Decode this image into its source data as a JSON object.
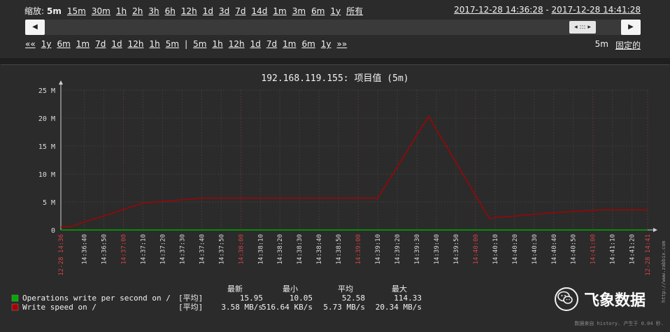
{
  "zoom": {
    "label": "缩放:",
    "options": [
      "5m",
      "15m",
      "30m",
      "1h",
      "2h",
      "3h",
      "6h",
      "12h",
      "1d",
      "3d",
      "7d",
      "14d",
      "1m",
      "3m",
      "6m",
      "1y",
      "所有"
    ],
    "selected": "5m"
  },
  "range": {
    "from": "2017-12-28 14:36:28",
    "dash": " - ",
    "to": "2017-12-28 14:41:28"
  },
  "scroll": {
    "left_arrow": "◀",
    "right_arrow": "▶",
    "handle": "◂ ::: ▸"
  },
  "nav": {
    "back_all": "««",
    "back": [
      "1y",
      "6m",
      "1m",
      "7d",
      "1d",
      "12h",
      "1h",
      "5m"
    ],
    "sep": "|",
    "fwd": [
      "5m",
      "1h",
      "12h",
      "1d",
      "7d",
      "1m",
      "6m",
      "1y"
    ],
    "fwd_all": "»»",
    "period": "5m",
    "fixed": "固定的"
  },
  "chart_data": {
    "type": "line",
    "title": "192.168.119.155: 项目值 (5m)",
    "xlabel": "",
    "ylabel": "",
    "ylim": [
      0,
      25000000
    ],
    "y_ticks": [
      "0",
      "5 M",
      "10 M",
      "15 M",
      "20 M",
      "25 M"
    ],
    "y_tick_values": [
      0,
      5000000,
      10000000,
      15000000,
      20000000,
      25000000
    ],
    "x_start": "14:36:28",
    "x_end": "14:41:28",
    "x_tick_labels": [
      {
        "t": "14:36:28",
        "label": "12-28 14:36",
        "red": true
      },
      {
        "t": "14:36:40",
        "label": "14:36:40",
        "red": false
      },
      {
        "t": "14:36:50",
        "label": "14:36:50",
        "red": false
      },
      {
        "t": "14:37:00",
        "label": "14:37:00",
        "red": true
      },
      {
        "t": "14:37:10",
        "label": "14:37:10",
        "red": false
      },
      {
        "t": "14:37:20",
        "label": "14:37:20",
        "red": false
      },
      {
        "t": "14:37:30",
        "label": "14:37:30",
        "red": false
      },
      {
        "t": "14:37:40",
        "label": "14:37:40",
        "red": false
      },
      {
        "t": "14:37:50",
        "label": "14:37:50",
        "red": false
      },
      {
        "t": "14:38:00",
        "label": "14:38:00",
        "red": true
      },
      {
        "t": "14:38:10",
        "label": "14:38:10",
        "red": false
      },
      {
        "t": "14:38:20",
        "label": "14:38:20",
        "red": false
      },
      {
        "t": "14:38:30",
        "label": "14:38:30",
        "red": false
      },
      {
        "t": "14:38:40",
        "label": "14:38:40",
        "red": false
      },
      {
        "t": "14:38:50",
        "label": "14:38:50",
        "red": false
      },
      {
        "t": "14:39:00",
        "label": "14:39:00",
        "red": true
      },
      {
        "t": "14:39:10",
        "label": "14:39:10",
        "red": false
      },
      {
        "t": "14:39:20",
        "label": "14:39:20",
        "red": false
      },
      {
        "t": "14:39:30",
        "label": "14:39:30",
        "red": false
      },
      {
        "t": "14:39:40",
        "label": "14:39:40",
        "red": false
      },
      {
        "t": "14:39:50",
        "label": "14:39:50",
        "red": false
      },
      {
        "t": "14:40:00",
        "label": "14:40:00",
        "red": true
      },
      {
        "t": "14:40:10",
        "label": "14:40:10",
        "red": false
      },
      {
        "t": "14:40:20",
        "label": "14:40:20",
        "red": false
      },
      {
        "t": "14:40:30",
        "label": "14:40:30",
        "red": false
      },
      {
        "t": "14:40:40",
        "label": "14:40:40",
        "red": false
      },
      {
        "t": "14:40:50",
        "label": "14:40:50",
        "red": false
      },
      {
        "t": "14:41:00",
        "label": "14:41:00",
        "red": true
      },
      {
        "t": "14:41:10",
        "label": "14:41:10",
        "red": false
      },
      {
        "t": "14:41:20",
        "label": "14:41:20",
        "red": false
      },
      {
        "t": "14:41:28",
        "label": "12-28 14:41",
        "red": true
      }
    ],
    "series": [
      {
        "name": "Operations write per second on /",
        "color": "#00aa00",
        "points": [
          [
            "14:36:28",
            16
          ],
          [
            "14:37:10",
            16
          ],
          [
            "14:38:00",
            16
          ],
          [
            "14:39:00",
            16
          ],
          [
            "14:40:00",
            16
          ],
          [
            "14:41:28",
            16
          ]
        ]
      },
      {
        "name": "Write speed on /",
        "color": "#aa0000",
        "points": [
          [
            "14:36:28",
            500000
          ],
          [
            "14:36:33",
            600000
          ],
          [
            "14:37:10",
            4800000
          ],
          [
            "14:37:40",
            5700000
          ],
          [
            "14:39:10",
            5700000
          ],
          [
            "14:39:36",
            20300000
          ],
          [
            "14:40:07",
            2100000
          ],
          [
            "14:40:40",
            3100000
          ],
          [
            "14:41:05",
            3600000
          ],
          [
            "14:41:28",
            3600000
          ]
        ]
      }
    ],
    "legend_header": [
      "最新",
      "最小",
      "平均",
      "最大"
    ],
    "legend_rows": [
      {
        "name": "Operations write per second on /",
        "func": "[平均]",
        "last": "15.95",
        "min": "10.05",
        "avg": "52.58",
        "max": "114.33",
        "color": "#00aa00"
      },
      {
        "name": "Write speed on /",
        "func": "[平均]",
        "last": "3.58 MB/s",
        "min": "516.64 KB/s",
        "avg": "5.73 MB/s",
        "max": "20.34 MB/s",
        "color": "#aa0000"
      }
    ],
    "side_credit": "http://www.zabbix.com",
    "footer_credit": "数据来自 history. 产生于 0.04 秒."
  },
  "watermark": {
    "icon": "wechat-icon",
    "text": "飞象数据"
  },
  "colors": {
    "bg": "#2b2b2b",
    "grid": "#3c3c3c",
    "axis": "#cfcfcf",
    "red_tick": "#d04444"
  }
}
